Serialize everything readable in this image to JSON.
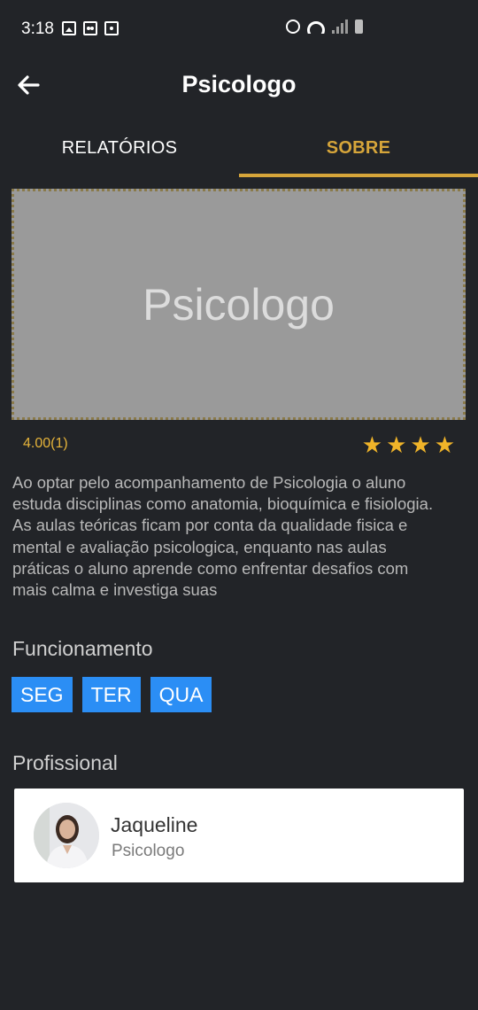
{
  "status_bar": {
    "time": "3:18",
    "left_icons": [
      "image-icon",
      "voicemail-icon",
      "camera-icon"
    ],
    "right_icons": [
      "alarm-icon",
      "wifi-icon",
      "signal-icon",
      "battery-icon"
    ]
  },
  "header": {
    "title": "Psicologo",
    "back_icon": "arrow-left-icon"
  },
  "tabs": [
    {
      "label": "RELATÓRIOS",
      "active": false
    },
    {
      "label": "SOBRE",
      "active": true
    }
  ],
  "banner": {
    "text": "Psicologo"
  },
  "rating": {
    "value_text": "4.00(1)",
    "stars": 4
  },
  "description": "Ao optar pelo acompanhamento de Psicologia o aluno estuda disciplinas como anatomia, bioquímica e fisiologia. As aulas teóricas ficam por conta da qualidade fisica e mental e avaliação psicologica, enquanto nas aulas práticas o aluno aprende como enfrentar desafios com mais calma e investiga suas",
  "schedule": {
    "title": "Funcionamento",
    "days": [
      "SEG",
      "TER",
      "QUA"
    ]
  },
  "professional": {
    "title": "Profissional",
    "name": "Jaqueline",
    "role": "Psicologo"
  },
  "colors": {
    "background": "#222428",
    "accent": "#d6a53a",
    "day_chip": "#2b8ef5",
    "star": "#f0b429"
  }
}
